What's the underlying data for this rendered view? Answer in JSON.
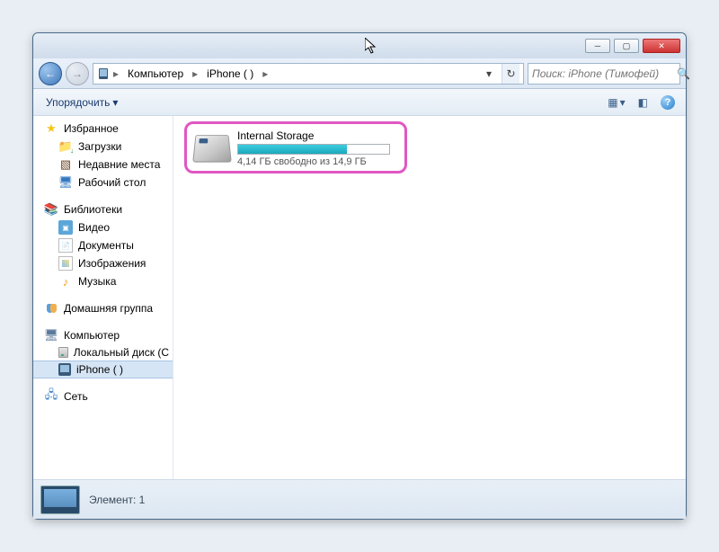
{
  "breadcrumb": {
    "seg1": "Компьютер",
    "seg2": "iPhone (               )"
  },
  "search": {
    "placeholder": "Поиск: iPhone (Тимофей)"
  },
  "toolbar": {
    "organize": "Упорядочить"
  },
  "sidebar": {
    "favorites": {
      "label": "Избранное",
      "items": [
        "Загрузки",
        "Недавние места",
        "Рабочий стол"
      ]
    },
    "libraries": {
      "label": "Библиотеки",
      "items": [
        "Видео",
        "Документы",
        "Изображения",
        "Музыка"
      ]
    },
    "homegroup": {
      "label": "Домашняя группа"
    },
    "computer": {
      "label": "Компьютер",
      "items": [
        "Локальный диск (C",
        "iPhone (               )"
      ]
    },
    "network": {
      "label": "Сеть"
    }
  },
  "content": {
    "drive": {
      "title": "Internal Storage",
      "sub": "4,14 ГБ свободно из 14,9 ГБ",
      "used_percent": 72
    }
  },
  "status": {
    "text": "Элемент: 1"
  }
}
